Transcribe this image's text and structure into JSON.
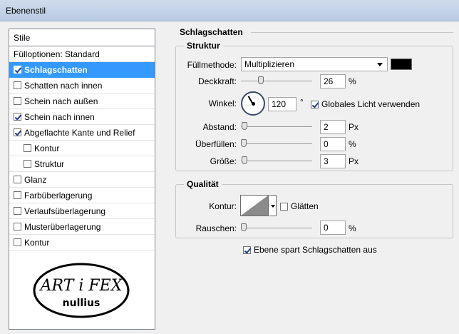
{
  "window": {
    "title": "Ebenenstil"
  },
  "stile_panel": {
    "header": "Stile",
    "items": [
      {
        "label": "Fülloptionen: Standard",
        "checkbox": false,
        "checked": false,
        "indent": 0,
        "selected": false
      },
      {
        "label": "Schlagschatten",
        "checkbox": true,
        "checked": true,
        "indent": 0,
        "selected": true
      },
      {
        "label": "Schatten nach innen",
        "checkbox": true,
        "checked": false,
        "indent": 0,
        "selected": false
      },
      {
        "label": "Schein nach außen",
        "checkbox": true,
        "checked": false,
        "indent": 0,
        "selected": false
      },
      {
        "label": "Schein nach innen",
        "checkbox": true,
        "checked": true,
        "indent": 0,
        "selected": false
      },
      {
        "label": "Abgeflachte Kante und Relief",
        "checkbox": true,
        "checked": true,
        "indent": 0,
        "selected": false
      },
      {
        "label": "Kontur",
        "checkbox": true,
        "checked": false,
        "indent": 1,
        "selected": false
      },
      {
        "label": "Struktur",
        "checkbox": true,
        "checked": false,
        "indent": 1,
        "selected": false
      },
      {
        "label": "Glanz",
        "checkbox": true,
        "checked": false,
        "indent": 0,
        "selected": false
      },
      {
        "label": "Farbüberlagerung",
        "checkbox": true,
        "checked": false,
        "indent": 0,
        "selected": false
      },
      {
        "label": "Verlaufsüberlagerung",
        "checkbox": true,
        "checked": false,
        "indent": 0,
        "selected": false
      },
      {
        "label": "Musterüberlagerung",
        "checkbox": true,
        "checked": false,
        "indent": 0,
        "selected": false
      },
      {
        "label": "Kontur",
        "checkbox": true,
        "checked": false,
        "indent": 0,
        "selected": false
      }
    ],
    "logo": {
      "top_text": "ART i FEX",
      "bottom_text": "nullius"
    }
  },
  "main": {
    "section_title": "Schlagschatten",
    "struktur": {
      "legend": "Struktur",
      "blend_mode_label": "Füllmethode:",
      "blend_mode_value": "Multiplizieren",
      "shadow_color": "#000000",
      "opacity_label": "Deckkraft:",
      "opacity_value": "26",
      "opacity_unit": "%",
      "opacity_fraction": 0.26,
      "angle_label": "Winkel:",
      "angle_value": "120",
      "angle_unit": "°",
      "angle_degrees": 120,
      "global_light_label": "Globales Licht verwenden",
      "global_light_checked": true,
      "distance_label": "Abstand:",
      "distance_value": "2",
      "distance_unit": "Px",
      "distance_fraction": 0.01,
      "spread_label": "Überfüllen:",
      "spread_value": "0",
      "spread_unit": "%",
      "spread_fraction": 0.0,
      "size_label": "Größe:",
      "size_value": "3",
      "size_unit": "Px",
      "size_fraction": 0.012
    },
    "qualitaet": {
      "legend": "Qualität",
      "contour_label": "Kontur:",
      "antialias_label": "Glätten",
      "antialias_checked": false,
      "noise_label": "Rauschen:",
      "noise_value": "0",
      "noise_unit": "%",
      "noise_fraction": 0.0
    },
    "knockout_label": "Ebene spart Schlagschatten aus",
    "knockout_checked": true
  },
  "colors": {
    "selection": "#3399ff",
    "panel_bg": "#f0f0f0",
    "check": "#1d3b8a"
  }
}
